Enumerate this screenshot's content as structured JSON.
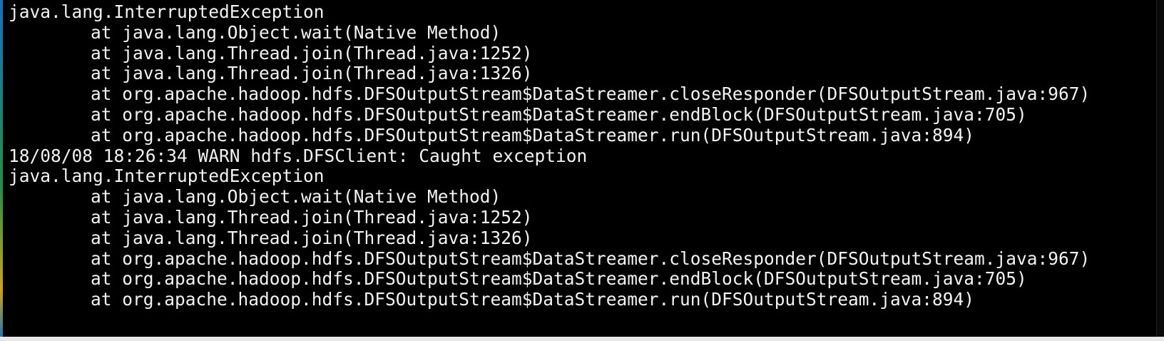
{
  "terminal": {
    "lines": [
      {
        "text": "java.lang.InterruptedException",
        "indent": false
      },
      {
        "text": "at java.lang.Object.wait(Native Method)",
        "indent": true
      },
      {
        "text": "at java.lang.Thread.join(Thread.java:1252)",
        "indent": true
      },
      {
        "text": "at java.lang.Thread.join(Thread.java:1326)",
        "indent": true
      },
      {
        "text": "at org.apache.hadoop.hdfs.DFSOutputStream$DataStreamer.closeResponder(DFSOutputStream.java:967)",
        "indent": true
      },
      {
        "text": "at org.apache.hadoop.hdfs.DFSOutputStream$DataStreamer.endBlock(DFSOutputStream.java:705)",
        "indent": true
      },
      {
        "text": "at org.apache.hadoop.hdfs.DFSOutputStream$DataStreamer.run(DFSOutputStream.java:894)",
        "indent": true
      },
      {
        "text": "18/08/08 18:26:34 WARN hdfs.DFSClient: Caught exception",
        "indent": false
      },
      {
        "text": "java.lang.InterruptedException",
        "indent": false
      },
      {
        "text": "at java.lang.Object.wait(Native Method)",
        "indent": true
      },
      {
        "text": "at java.lang.Thread.join(Thread.java:1252)",
        "indent": true
      },
      {
        "text": "at java.lang.Thread.join(Thread.java:1326)",
        "indent": true
      },
      {
        "text": "at org.apache.hadoop.hdfs.DFSOutputStream$DataStreamer.closeResponder(DFSOutputStream.java:967)",
        "indent": true
      },
      {
        "text": "at org.apache.hadoop.hdfs.DFSOutputStream$DataStreamer.endBlock(DFSOutputStream.java:705)",
        "indent": true
      },
      {
        "text": "at org.apache.hadoop.hdfs.DFSOutputStream$DataStreamer.run(DFSOutputStream.java:894)",
        "indent": true
      }
    ]
  },
  "colors": {
    "background": "#000000",
    "text": "#f2f2f2"
  }
}
